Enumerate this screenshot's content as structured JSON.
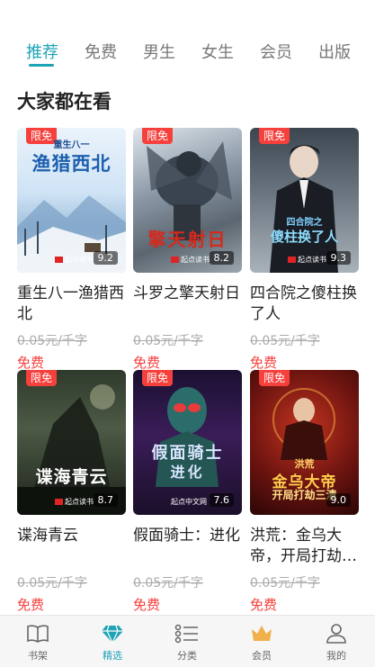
{
  "tabs": [
    {
      "label": "推荐",
      "active": true
    },
    {
      "label": "免费",
      "active": false
    },
    {
      "label": "男生",
      "active": false
    },
    {
      "label": "女生",
      "active": false
    },
    {
      "label": "会员",
      "active": false
    },
    {
      "label": "出版",
      "active": false
    }
  ],
  "section": {
    "title": "大家都在看"
  },
  "books": [
    {
      "badge": "限免",
      "cover_title": "渔猎西北",
      "cover_subtitle": "重生八一",
      "publisher": "起点读书",
      "score": "9.2",
      "title": "重生八一渔猎西北",
      "price": "0.05元/千字",
      "free": "免费"
    },
    {
      "badge": "限免",
      "cover_title": "擎天射日",
      "publisher": "起点读书",
      "score": "8.2",
      "title": "斗罗之擎天射日",
      "price": "0.05元/千字",
      "free": "免费"
    },
    {
      "badge": "限免",
      "cover_title": "傻柱换了人",
      "cover_subtitle": "四合院之",
      "publisher": "起点读书",
      "score": "9.3",
      "title": "四合院之傻柱换了人",
      "price": "0.05元/千字",
      "free": "免费"
    },
    {
      "badge": "限免",
      "cover_title": "谍海青云",
      "publisher": "起点读书",
      "score": "8.7",
      "title": "谍海青云",
      "price": "0.05元/千字",
      "free": "免费"
    },
    {
      "badge": "限免",
      "cover_title": "假面骑士",
      "cover_subtitle": "进化",
      "publisher": "起点中文网",
      "score": "7.6",
      "title": "假面骑士：进化",
      "price": "0.05元/千字",
      "free": "免费"
    },
    {
      "badge": "限免",
      "cover_title": "金乌大帝",
      "cover_subtitle": "开局打劫三清",
      "cover_top": "洪荒",
      "score": "9.0",
      "title": "洪荒：金乌大帝，开局打劫…",
      "price": "0.05元/千字",
      "free": "免费"
    }
  ],
  "nav": [
    {
      "label": "书架",
      "icon": "book-icon",
      "active": false
    },
    {
      "label": "精选",
      "icon": "diamond-icon",
      "active": true
    },
    {
      "label": "分类",
      "icon": "list-icon",
      "active": false
    },
    {
      "label": "会员",
      "icon": "crown-icon",
      "active": false
    },
    {
      "label": "我的",
      "icon": "person-icon",
      "active": false
    }
  ],
  "colors": {
    "accent": "#1fa3b7",
    "badge": "#f5403c",
    "free": "#f5403c",
    "crown": "#f0b04b"
  }
}
